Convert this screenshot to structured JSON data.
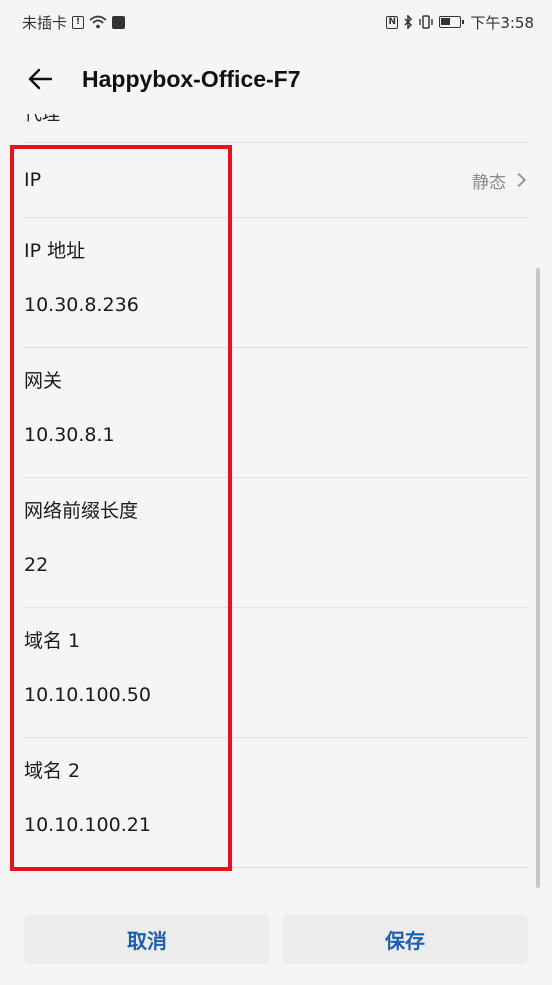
{
  "status_bar": {
    "carrier": "未插卡",
    "time": "下午3:58"
  },
  "app_bar": {
    "title": "Happybox-Office-F7"
  },
  "partial_row": {
    "label": "代理"
  },
  "ip_row": {
    "label": "IP",
    "value": "静态"
  },
  "fields": [
    {
      "label": "IP 地址",
      "value": "10.30.8.236"
    },
    {
      "label": "网关",
      "value": "10.30.8.1"
    },
    {
      "label": "网络前缀长度",
      "value": "22"
    },
    {
      "label": "域名 1",
      "value": "10.10.100.50"
    },
    {
      "label": "域名 2",
      "value": "10.10.100.21"
    }
  ],
  "buttons": {
    "cancel": "取消",
    "save": "保存"
  },
  "colors": {
    "accent": "#1b5fae",
    "highlight": "#e5141b"
  }
}
